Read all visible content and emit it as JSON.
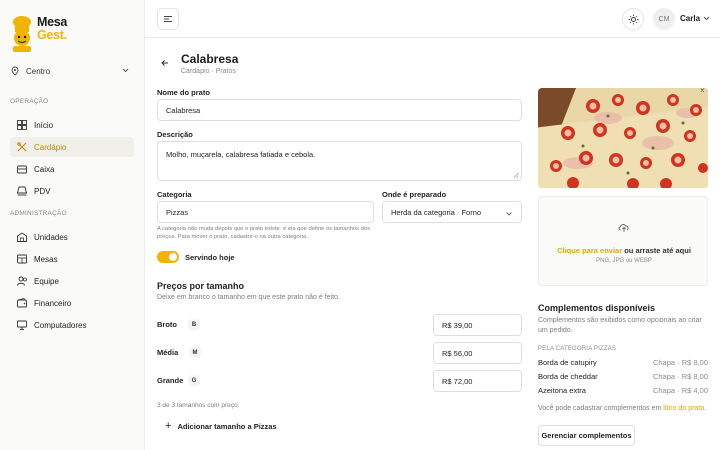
{
  "brand": {
    "line1": "Mesa",
    "line2": "Gest."
  },
  "sidebar": {
    "location": "Centro",
    "section_operacao": "OPERAÇÃO",
    "section_admin": "ADMINISTRAÇÃO",
    "items": [
      {
        "label": "Início",
        "icon": "home-icon"
      },
      {
        "label": "Cardápio",
        "icon": "utensils-icon",
        "active": true
      },
      {
        "label": "Caixa",
        "icon": "cash-register-icon"
      },
      {
        "label": "PDV",
        "icon": "pos-icon"
      },
      {
        "label": "Unidades",
        "icon": "building-icon"
      },
      {
        "label": "Mesas",
        "icon": "table-icon"
      },
      {
        "label": "Equipe",
        "icon": "users-icon"
      },
      {
        "label": "Financeiro",
        "icon": "wallet-icon"
      },
      {
        "label": "Computadores",
        "icon": "monitor-icon"
      }
    ]
  },
  "header": {
    "avatar_initials": "CM",
    "user_name": "Carla"
  },
  "page": {
    "title": "Calabresa",
    "breadcrumb": "Cardápio · Pratos"
  },
  "form": {
    "name_label": "Nome do prato",
    "name_value": "Calabresa",
    "desc_label": "Descrição",
    "desc_value": "Molho, muçarela, calabresa fatiada e cebola.",
    "category_label": "Categoria",
    "category_value": "Pizzas",
    "prep_label": "Onde é preparado",
    "prep_value": "Herda da categoria · Forno",
    "category_hint": "A categoria não muda depois que o prato existe: é ela que define os tamanhos dos preços. Para mover o prato, cadastre-o na outra categoria.",
    "serving_label": "Servindo hoje",
    "serving_on": true
  },
  "prices": {
    "title": "Preços por tamanho",
    "subtitle": "Deixe em branco o tamanho em que este prato não é feito.",
    "sizes": [
      {
        "name": "Broto",
        "code": "B",
        "price": "R$ 39,00"
      },
      {
        "name": "Média",
        "code": "M",
        "price": "R$ 56,00"
      },
      {
        "name": "Grande",
        "code": "G",
        "price": "R$ 72,00"
      }
    ],
    "count_text": "3 de 3 tamanhos com preço.",
    "add_label": "Adicionar tamanho a Pizzas"
  },
  "upload": {
    "close": "×",
    "link_text": "Clique para enviar",
    "rest_text": " ou arraste até aqui",
    "formats": "PNG, JPG ou WEBP"
  },
  "complements": {
    "title": "Complementos disponíveis",
    "description": "Complementos são exibidos como opcionais ao criar um pedido.",
    "category_label": "PELA CATEGORIA PIZZAS",
    "items": [
      {
        "name": "Borda de catupiry",
        "price": "Chapa · R$ 8,00"
      },
      {
        "name": "Borda de cheddar",
        "price": "Chapa · R$ 8,00"
      },
      {
        "name": "Azeitona extra",
        "price": "Chapa · R$ 4,00"
      }
    ],
    "note_prefix": "Você pode cadastrar complementos em ",
    "note_link": "libro do prato",
    "note_suffix": ".",
    "manage_label": "Gerenciar complementos"
  },
  "colors": {
    "accent": "#f2b400",
    "active_bg": "#f0efea",
    "active_text": "#b88a00"
  }
}
